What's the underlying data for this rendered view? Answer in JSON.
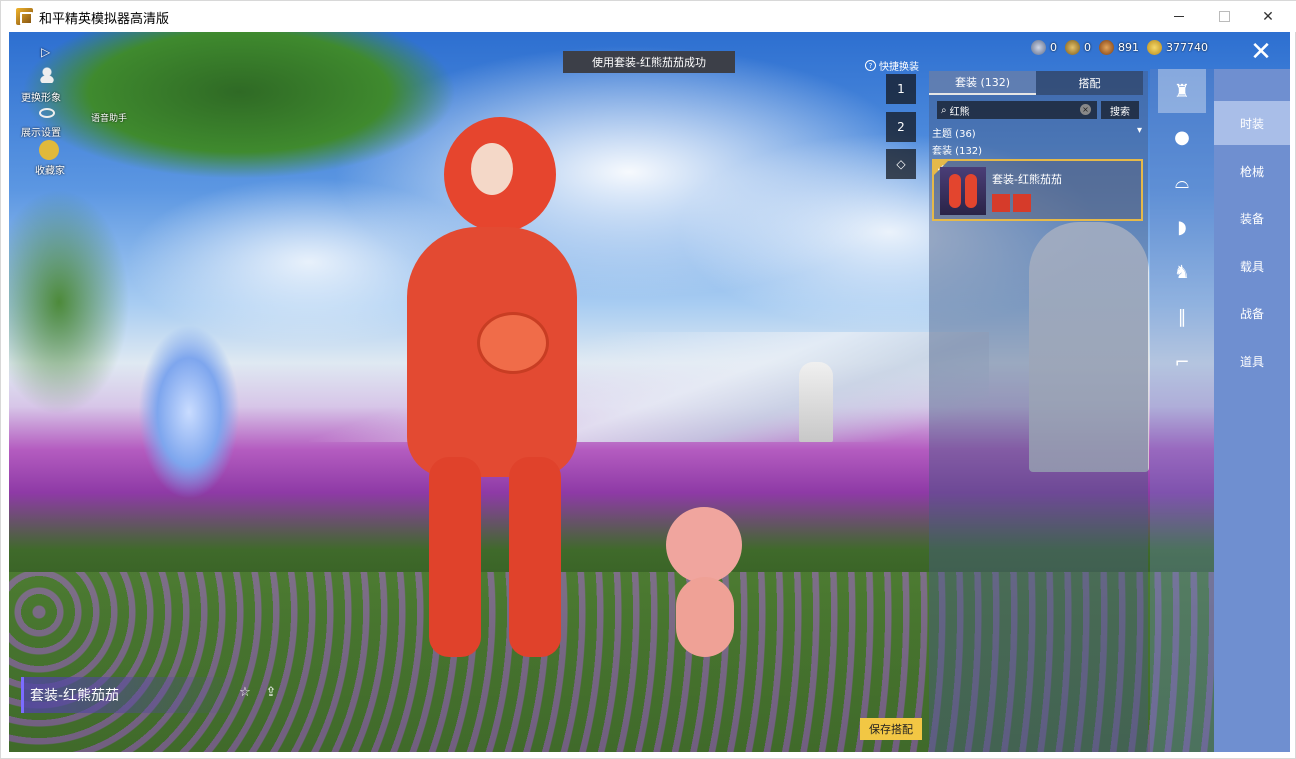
{
  "window": {
    "title": "和平精英模拟器高清版"
  },
  "toast": "使用套装-红熊茄茄成功",
  "left_menu": {
    "change_look": "更换形象",
    "display_settings": "展示设置",
    "voice_assistant": "语音助手",
    "collection": "收藏家"
  },
  "currency": {
    "c1": "0",
    "c2": "0",
    "c3": "891",
    "c4": "377740"
  },
  "quick_swap": "快捷换装",
  "slots": [
    "1",
    "2",
    ""
  ],
  "panel": {
    "tab_suits": "套装 (132)",
    "tab_match": "搭配",
    "search_value": "红熊",
    "search_button": "搜索",
    "filter_theme": "主题 (36)",
    "suits_count": "套装 (132)",
    "selected_outfit": "套装-红熊茄茄"
  },
  "categories": [
    "时装",
    "枪械",
    "装备",
    "载具",
    "战备",
    "道具"
  ],
  "bottom": {
    "outfit_label": "套装-红熊茄茄",
    "save_button": "保存搭配"
  },
  "colors": {
    "accent_gold": "#e5b94a",
    "save_yellow": "#f2c744",
    "nav_blue": "#6f8fd0"
  }
}
